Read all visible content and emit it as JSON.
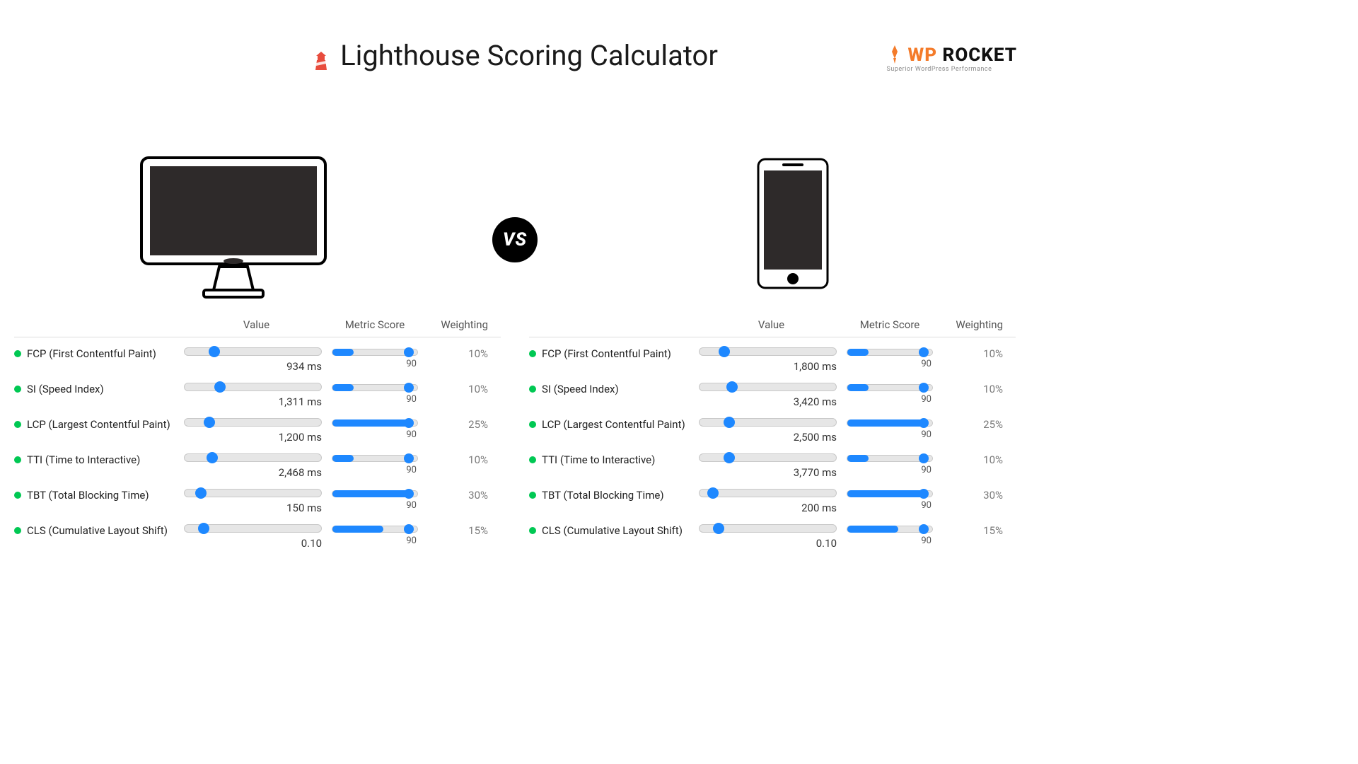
{
  "brand": {
    "name_a": "WP",
    "name_b": " ROCKET",
    "tagline": "Superior WordPress Performance"
  },
  "title": "Lighthouse Scoring Calculator",
  "vs": "VS",
  "headers": {
    "value": "Value",
    "metric_score": "Metric Score",
    "weighting": "Weighting"
  },
  "desktop": {
    "metrics": [
      {
        "label": "FCP (First Contentful Paint)",
        "value": "934 ms",
        "slider_pct": 22,
        "score": "90",
        "score_pct": 90,
        "fill_pct": 25,
        "weight": "10%"
      },
      {
        "label": "SI (Speed Index)",
        "value": "1,311 ms",
        "slider_pct": 26,
        "score": "90",
        "score_pct": 90,
        "fill_pct": 25,
        "weight": "10%"
      },
      {
        "label": "LCP (Largest Contentful Paint)",
        "value": "1,200 ms",
        "slider_pct": 18,
        "score": "90",
        "score_pct": 90,
        "fill_pct": 90,
        "weight": "25%"
      },
      {
        "label": "TTI (Time to Interactive)",
        "value": "2,468 ms",
        "slider_pct": 20,
        "score": "90",
        "score_pct": 90,
        "fill_pct": 25,
        "weight": "10%"
      },
      {
        "label": "TBT (Total Blocking Time)",
        "value": "150 ms",
        "slider_pct": 12,
        "score": "90",
        "score_pct": 90,
        "fill_pct": 90,
        "weight": "30%"
      },
      {
        "label": "CLS (Cumulative Layout Shift)",
        "value": "0.10",
        "slider_pct": 14,
        "score": "90",
        "score_pct": 90,
        "fill_pct": 60,
        "weight": "15%"
      }
    ]
  },
  "mobile": {
    "metrics": [
      {
        "label": "FCP (First Contentful Paint)",
        "value": "1,800 ms",
        "slider_pct": 18,
        "score": "90",
        "score_pct": 90,
        "fill_pct": 25,
        "weight": "10%"
      },
      {
        "label": "SI (Speed Index)",
        "value": "3,420 ms",
        "slider_pct": 24,
        "score": "90",
        "score_pct": 90,
        "fill_pct": 25,
        "weight": "10%"
      },
      {
        "label": "LCP (Largest Contentful Paint)",
        "value": "2,500 ms",
        "slider_pct": 22,
        "score": "90",
        "score_pct": 90,
        "fill_pct": 90,
        "weight": "25%"
      },
      {
        "label": "TTI (Time to Interactive)",
        "value": "3,770 ms",
        "slider_pct": 22,
        "score": "90",
        "score_pct": 90,
        "fill_pct": 25,
        "weight": "10%"
      },
      {
        "label": "TBT (Total Blocking Time)",
        "value": "200 ms",
        "slider_pct": 10,
        "score": "90",
        "score_pct": 90,
        "fill_pct": 90,
        "weight": "30%"
      },
      {
        "label": "CLS (Cumulative Layout Shift)",
        "value": "0.10",
        "slider_pct": 14,
        "score": "90",
        "score_pct": 90,
        "fill_pct": 60,
        "weight": "15%"
      }
    ]
  }
}
